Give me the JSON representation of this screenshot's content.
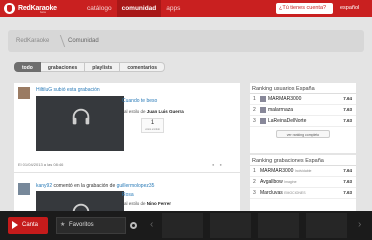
{
  "header": {
    "logo_text": "RedKaraoke",
    "logo_sub": "beta",
    "nav": [
      "catálogo",
      "comunidad",
      "apps"
    ],
    "account_button": "¿Tú tienes cuenta?",
    "language": "español"
  },
  "breadcrumb": {
    "home": "RedKaraoke",
    "current": "Comunidad"
  },
  "filters": [
    "todo",
    "grabaciones",
    "playlists",
    "comentarios"
  ],
  "feed": {
    "posts": [
      {
        "user": "HiltiluG",
        "action": "subió esta grabación",
        "song_title": "Cuando te beso",
        "artist_prefix": "al estilo de",
        "artist": "Juan Luis Guerra",
        "votes": "1",
        "votes_label": "votos emitido",
        "date": "El 01/04/2013 a las 08:46",
        "tools": "● ●"
      },
      {
        "user": "kany92",
        "action": "comentó en la grabación de",
        "target_user": "guillermolopez35",
        "song_title": "Rosa",
        "artist_prefix": "al estilo de",
        "artist": "Nino Ferrer"
      }
    ]
  },
  "rankings_users": {
    "title": "Ranking usuarios España",
    "rows": [
      {
        "rank": "1",
        "name": "MARMAR3000",
        "sub": "",
        "score": "7.64"
      },
      {
        "rank": "2",
        "name": "malarrnaza",
        "sub": "",
        "score": "7.63"
      },
      {
        "rank": "3",
        "name": "LaReinaDelNorte",
        "sub": "",
        "score": "7.63"
      }
    ],
    "more": "ver ranking completo"
  },
  "rankings_recordings": {
    "title": "Ranking grabaciones España",
    "rows": [
      {
        "rank": "1",
        "name": "MARMAR3000",
        "sub": "Inolvidable",
        "score": "7.64"
      },
      {
        "rank": "2",
        "name": "Avgallbow",
        "sub": "Imagine",
        "score": "7.63"
      },
      {
        "rank": "3",
        "name": "Marcluvas",
        "sub": "EMOCIONES",
        "score": "7.63"
      }
    ]
  },
  "player": {
    "canta": "Canta",
    "favoritos": "Favoritos"
  },
  "colors": {
    "brand": "#c92020",
    "link": "#2a7bb8",
    "dark": "#1b1b1b"
  }
}
